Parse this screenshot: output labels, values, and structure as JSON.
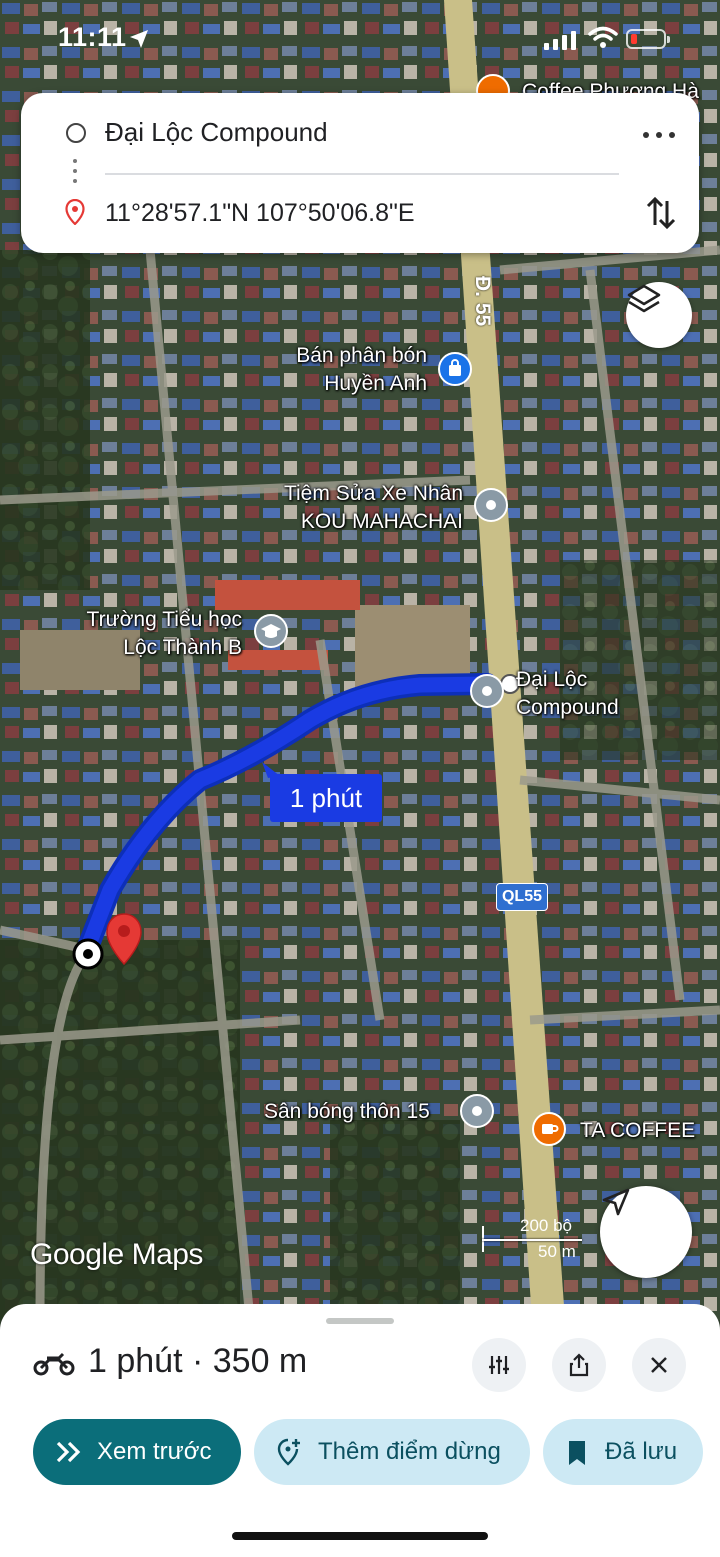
{
  "status_bar": {
    "time": "11:11"
  },
  "route": {
    "origin": "Đại Lộc Compound",
    "destination": "11°28'57.1\"N 107°50'06.8\"E"
  },
  "map": {
    "road_name": "Đ. 55",
    "highway_badge": "QL55",
    "route_duration_label": "1 phút",
    "pois": {
      "partial_top": "Coffee Phương Hà",
      "fertilizer_line1": "Bán phân bón",
      "fertilizer_line2": "Huyền Anh",
      "repair_line1": "Tiệm Sửa Xe Nhân",
      "repair_line2": "KOU MAHACHAI",
      "school_line1": "Trường Tiểu học",
      "school_line2": "Lộc Thành B",
      "compound_line1": "Đại Lộc",
      "compound_line2": "Compound",
      "field": "Sân bóng thôn 15",
      "coffee": "TA COFFEE"
    },
    "brand": "Google Maps",
    "scale": {
      "imperial": "200 bộ",
      "metric": "50 m"
    }
  },
  "sheet": {
    "summary": "1 phút · 350 m",
    "buttons": {
      "preview": "Xem trước",
      "add_stop": "Thêm điểm dừng",
      "saved": "Đã lưu"
    }
  },
  "colors": {
    "route_blue": "#1a3be3",
    "primary": "#0b6e7a",
    "secondary": "#cde9f4",
    "pin_red": "#e53935"
  }
}
